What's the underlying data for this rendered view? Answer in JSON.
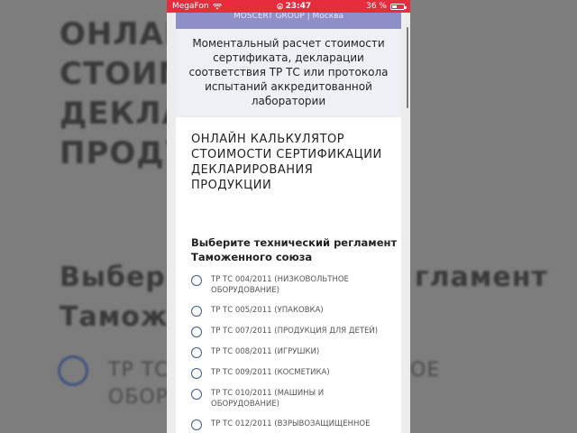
{
  "status_bar": {
    "carrier": "MegaFon",
    "time": "23:47",
    "battery": "36 %"
  },
  "header": {
    "text": "MOSCERT GROUP | Москва"
  },
  "promo": {
    "text": "Моментальный расчет стоимости сертификата, декларации соответствия ТР ТС или протокола испытаний аккредитованной лаборатории"
  },
  "calculator": {
    "title": "ОНЛАЙН КАЛЬКУЛЯТОР СТОИМОСТИ СЕРТИФИКАЦИИ ДЕКЛАРИРОВАНИЯ ПРОДУКЦИИ",
    "question": "Выберите технический регламент Таможенного союза",
    "options": [
      "ТР ТС 004/2011 (НИЗКОВОЛЬТНОЕ ОБОРУДОВАНИЕ)",
      "ТР ТС 005/2011 (УПАКОВКА)",
      "ТР ТС 007/2011 (ПРОДУКЦИЯ ДЛЯ ДЕТЕЙ)",
      "ТР ТС 008/2011 (ИГРУШКИ)",
      "ТР ТС 009/2011 (КОСМЕТИКА)",
      "ТР ТС 010/2011 (МАШИНЫ И ОБОРУДОВАНИЕ)",
      "ТР ТС 012/2011 (ВЗРЫВОЗАЩИЩЕННОЕ"
    ]
  },
  "background": {
    "line1": "ОНЛАЙ",
    "line2": "СТОИМ",
    "line3": "ДЕКЛА",
    "line4": "ПРОДУ",
    "line5_left": "Выберит",
    "line5_right": "гламент",
    "line6": "Таможен",
    "line7_left": "ТР ТС",
    "line7_right": "ОЕ",
    "line8": "ОБОРУ"
  },
  "colors": {
    "status_bar": "#e62d3d",
    "header": "#8e8fc9",
    "radio": "#3b5a8c"
  }
}
